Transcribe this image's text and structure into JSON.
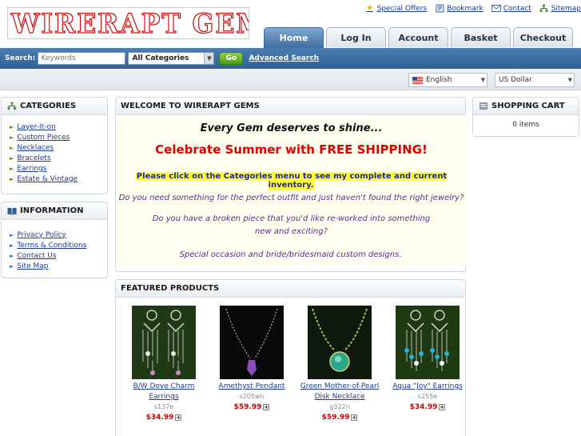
{
  "header": {
    "logo_text": "WIRERAPT GEMS",
    "top_links": [
      {
        "label": "Special Offers",
        "icon": "star-icon"
      },
      {
        "label": "Bookmark",
        "icon": "bookmark-icon"
      },
      {
        "label": "Contact",
        "icon": "mail-icon"
      },
      {
        "label": "Sitemap",
        "icon": "sitemap-icon"
      }
    ],
    "tabs": [
      "Home",
      "Log In",
      "Account",
      "Basket",
      "Checkout"
    ],
    "active_tab": "Home"
  },
  "search": {
    "label": "Search:",
    "placeholder": "Keywords",
    "category": "All Categories",
    "go_label": "Go",
    "advanced_label": "Advanced Search"
  },
  "selectors": {
    "language": "English",
    "currency": "US Dollar"
  },
  "sidebar": {
    "categories_title": "CATEGORIES",
    "categories": [
      "Layer-it-on",
      "Custom Pieces",
      "Necklaces",
      "Bracelets",
      "Earrings",
      "Estate & Vintage"
    ],
    "information_title": "INFORMATION",
    "information": [
      "Privacy Policy",
      "Terms & Conditions",
      "Contact Us",
      "Site Map"
    ]
  },
  "welcome": {
    "title": "WELCOME TO WIRERAPT GEMS",
    "tagline": "Every Gem deserves to shine...",
    "promo": "Celebrate Summer with FREE SHIPPING!",
    "notice": "Please click on the Categories menu to see my complete and current inventory.",
    "line1": "Do you need something for the perfect outfit and just haven't found the right jewelry?",
    "line2": "Do you have a broken piece that you'd like re-worked into something new and exciting?",
    "line3": "Special occasion and bride/bridesmaid custom designs."
  },
  "cart": {
    "title": "SHOPPING CART",
    "items": "0 items"
  },
  "featured": {
    "title": "FEATURED PRODUCTS",
    "products": [
      {
        "name": "B/W Dove Charm Earrings",
        "code": "s137e",
        "price": "$34.99"
      },
      {
        "name": "Amethyst Pendant",
        "code": "s205wn",
        "price": "$59.99"
      },
      {
        "name": "Green Mother-of-Pearl Disk Necklace",
        "code": "g322n",
        "price": "$59.99"
      },
      {
        "name": "Aqua \"Joy\" Earrings",
        "code": "s255e",
        "price": "$34.99"
      }
    ]
  },
  "colors": {
    "nav_blue": "#3e6ea0",
    "promo_red": "#e10000",
    "highlight_yellow": "#ffff33",
    "italic_purple": "#5b2a92",
    "price_red": "#cc0000"
  }
}
